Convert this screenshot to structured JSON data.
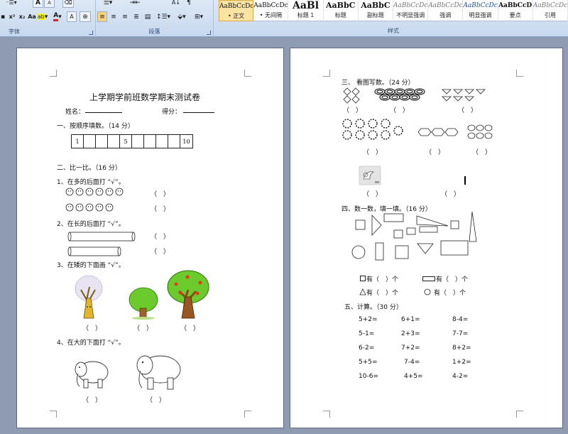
{
  "ribbon": {
    "font_group_label": "字体",
    "paragraph_group_label": "段落",
    "styles_group_label": "样式",
    "font_buttons": [
      "A",
      "A",
      "x²",
      "x₂",
      "Aa",
      "A",
      "A"
    ],
    "styles": [
      {
        "preview": "AaBbCcDc",
        "name": "• 正文"
      },
      {
        "preview": "AaBbCcDc",
        "name": "• 无间隔"
      },
      {
        "preview": "AaBl",
        "name": "标题 1"
      },
      {
        "preview": "AaBbC",
        "name": "标题"
      },
      {
        "preview": "AaBbC",
        "name": "副标题"
      },
      {
        "preview": "AaBbCcDc",
        "name": "不明显强调"
      },
      {
        "preview": "AaBbCcDc",
        "name": "强调"
      },
      {
        "preview": "AaBbCcDc",
        "name": "明显强调"
      },
      {
        "preview": "AaBbCcD",
        "name": "要点"
      },
      {
        "preview": "AaBbCcDc",
        "name": "引用"
      }
    ]
  },
  "left_page": {
    "title": "上学期学前班数学期末测试卷",
    "name_label": "姓名：",
    "score_label": "得分：",
    "section1": "一、按顺序填数。（14 分）",
    "number_cells": [
      "1",
      "",
      "",
      "",
      "5",
      "",
      "",
      "",
      "",
      "10"
    ],
    "section2": "二、比一比。（16 分）",
    "q1": "1、在多的后面打 “√”。",
    "q2": "2、在长的后面打 “√”。",
    "q3": "3、在矮的下面画 “√”。",
    "q4": "4、在大的下面打 “√”。",
    "paren": "（　）"
  },
  "right_page": {
    "section3": "三、 看图写数。（24 分）",
    "section4": "四、数一数，填一填。（16 分）",
    "count_square": "有（　）个",
    "count_rect": "有（　）个",
    "count_triangle": "有（　）个",
    "count_circle": "有（　）个",
    "section5": "五、计算。（30 分）",
    "paren": "（　）",
    "math": [
      [
        "5+2=",
        "6+1=",
        "8-4="
      ],
      [
        "5-1=",
        "2+3=",
        "7-7="
      ],
      [
        "6-2=",
        "7+2=",
        "8+2="
      ],
      [
        "5+5=",
        "7-4=",
        "1+2="
      ],
      [
        "10-6=",
        "4+5=",
        "4-2="
      ]
    ]
  }
}
